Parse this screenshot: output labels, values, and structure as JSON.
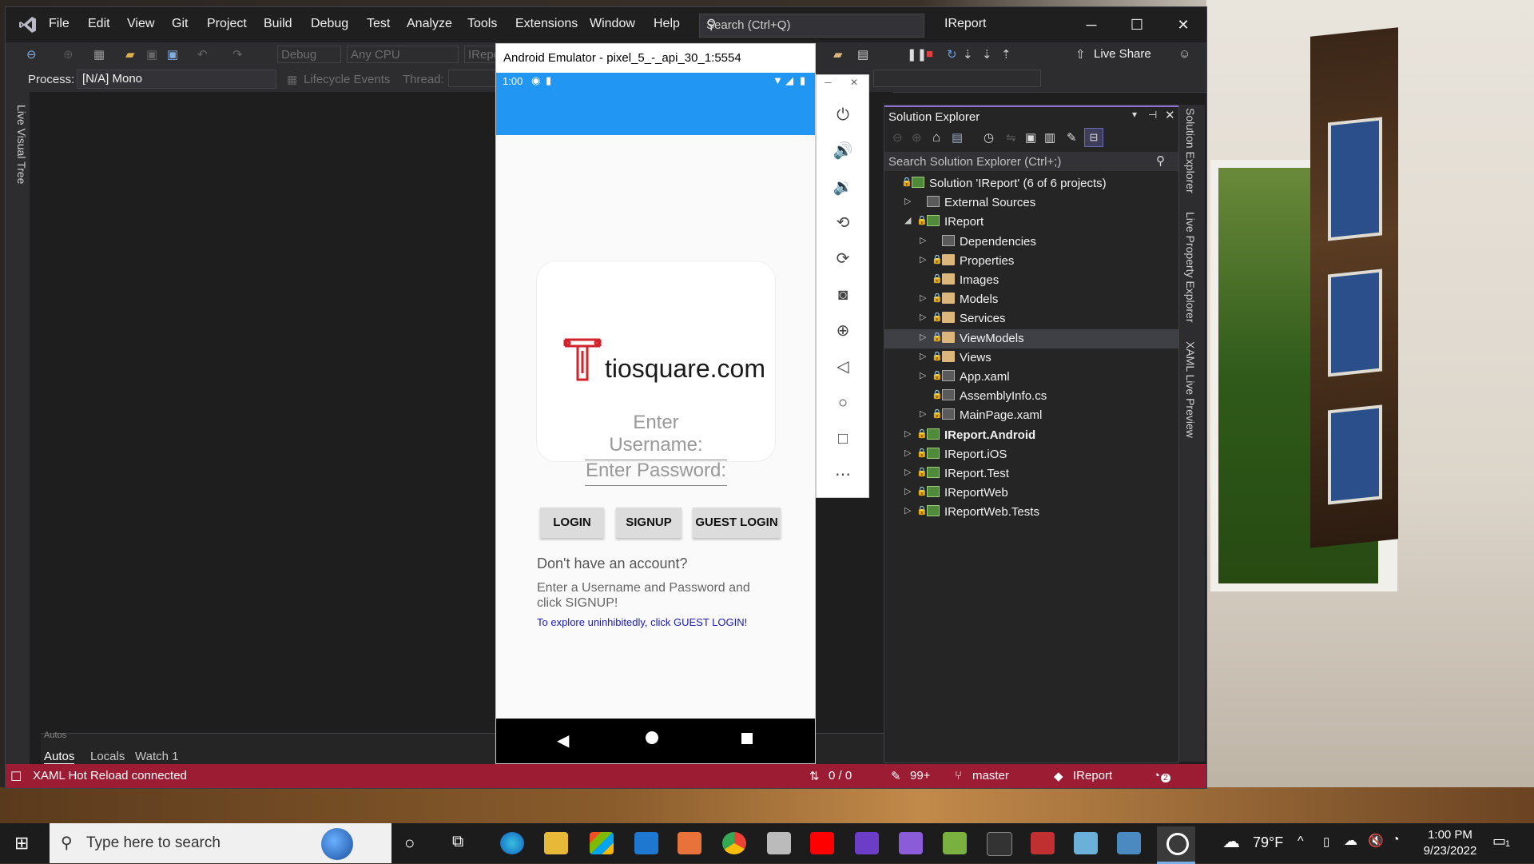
{
  "menu": [
    "File",
    "Edit",
    "View",
    "Git",
    "Project",
    "Build",
    "Debug",
    "Test",
    "Analyze",
    "Tools",
    "Extensions",
    "Window",
    "Help"
  ],
  "search_placeholder": "Search (Ctrl+Q)",
  "app_title": "IReport",
  "toolbar": {
    "config": "Debug",
    "platform": "Any CPU",
    "startup": "IRepo",
    "live_share": "Live Share"
  },
  "debug_bar": {
    "process_label": "Process:",
    "process_value": "[N/A] Mono",
    "lifecycle": "Lifecycle Events",
    "thread": "Thread:"
  },
  "left_strip": "Live Visual Tree",
  "bottom_tabs": {
    "header": "Autos",
    "tabs": [
      "Autos",
      "Locals",
      "Watch 1"
    ]
  },
  "status": {
    "message": "XAML Hot Reload connected",
    "lines": "0 / 0",
    "edits": "99+",
    "branch": "master",
    "project": "IReport",
    "notifications": "2"
  },
  "solution_explorer": {
    "title": "Solution Explorer",
    "search": "Search Solution Explorer (Ctrl+;)",
    "items": [
      {
        "label": "Solution 'IReport' (6 of 6 projects)",
        "level": 0,
        "expander": "",
        "lock": true,
        "icon": "solution"
      },
      {
        "label": "External Sources",
        "level": 1,
        "expander": "▷",
        "lock": false,
        "icon": "extsrc"
      },
      {
        "label": "IReport",
        "level": 1,
        "expander": "◢",
        "lock": true,
        "icon": "proj"
      },
      {
        "label": "Dependencies",
        "level": 2,
        "expander": "▷",
        "lock": false,
        "icon": "deps"
      },
      {
        "label": "Properties",
        "level": 2,
        "expander": "▷",
        "lock": true,
        "icon": "folder"
      },
      {
        "label": "Images",
        "level": 2,
        "expander": "",
        "lock": true,
        "icon": "folder"
      },
      {
        "label": "Models",
        "level": 2,
        "expander": "▷",
        "lock": true,
        "icon": "folder"
      },
      {
        "label": "Services",
        "level": 2,
        "expander": "▷",
        "lock": true,
        "icon": "folder"
      },
      {
        "label": "ViewModels",
        "level": 2,
        "expander": "▷",
        "lock": true,
        "icon": "folder",
        "selected": true
      },
      {
        "label": "Views",
        "level": 2,
        "expander": "▷",
        "lock": true,
        "icon": "folder"
      },
      {
        "label": "App.xaml",
        "level": 2,
        "expander": "▷",
        "lock": true,
        "icon": "file"
      },
      {
        "label": "AssemblyInfo.cs",
        "level": 2,
        "expander": "",
        "lock": true,
        "icon": "cs"
      },
      {
        "label": "MainPage.xaml",
        "level": 2,
        "expander": "▷",
        "lock": true,
        "icon": "file"
      },
      {
        "label": "IReport.Android",
        "level": 1,
        "expander": "▷",
        "lock": true,
        "icon": "proj",
        "bold": true
      },
      {
        "label": "IReport.iOS",
        "level": 1,
        "expander": "▷",
        "lock": true,
        "icon": "proj"
      },
      {
        "label": "IReport.Test",
        "level": 1,
        "expander": "▷",
        "lock": true,
        "icon": "proj"
      },
      {
        "label": "IReportWeb",
        "level": 1,
        "expander": "▷",
        "lock": true,
        "icon": "proj"
      },
      {
        "label": "IReportWeb.Tests",
        "level": 1,
        "expander": "▷",
        "lock": true,
        "icon": "proj"
      }
    ]
  },
  "right_tabs": [
    "Solution Explorer",
    "Live Property Explorer",
    "XAML Live Preview"
  ],
  "emulator": {
    "title": "Android Emulator - pixel_5_-_api_30_1:5554",
    "time": "1:00",
    "logo_text": "tiosquare.com",
    "username_placeholder": "Enter Username:",
    "password_placeholder": "Enter Password:",
    "buttons": [
      "LOGIN",
      "SIGNUP",
      "GUEST LOGIN"
    ],
    "no_account": "Don't have an account?",
    "signup_hint": "Enter a Username and Password and click SIGNUP!",
    "guest_hint": "To explore uninhibitedly, click GUEST LOGIN!"
  },
  "taskbar": {
    "search": "Type here to search",
    "weather": "79°F",
    "time": "1:00 PM",
    "date": "9/23/2022",
    "notif_count": "1"
  },
  "colors": {
    "accent": "#2196f3",
    "status_bar": "#9c1c34",
    "guest_link": "#1a1ab5"
  }
}
